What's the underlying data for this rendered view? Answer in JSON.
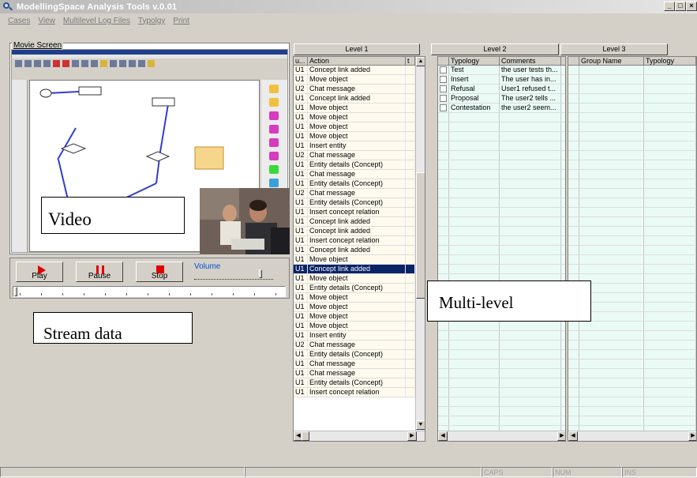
{
  "window": {
    "title": "ModellingSpace Analysis Tools v.0.01",
    "min": "_",
    "max": "□",
    "close": "×"
  },
  "menu": [
    "Cases",
    "View",
    "Multilevel Log Files",
    "Typolgy",
    "Print"
  ],
  "movie": {
    "title": "Movie Screen",
    "video_label": "Video",
    "controls": {
      "play": "Play",
      "pause": "Pause",
      "stop": "Stop",
      "volume_label": "Volume",
      "volume_level": 0.85
    },
    "stream_label": "Stream data"
  },
  "levels": {
    "level1": {
      "tab": "Level 1",
      "columns": [
        "u...",
        "Action",
        "t"
      ],
      "rows": [
        [
          "U1",
          "Concept link added"
        ],
        [
          "U1",
          "Move object"
        ],
        [
          "U2",
          "Chat message"
        ],
        [
          "U1",
          "Concept link added"
        ],
        [
          "U1",
          "Move object"
        ],
        [
          "U1",
          "Move object"
        ],
        [
          "U1",
          "Move object"
        ],
        [
          "U1",
          "Move object"
        ],
        [
          "U1",
          "Insert entity"
        ],
        [
          "U2",
          "Chat message"
        ],
        [
          "U1",
          "Entity details (Concept)"
        ],
        [
          "U1",
          "Chat message"
        ],
        [
          "U1",
          "Entity details (Concept)"
        ],
        [
          "U2",
          "Chat message"
        ],
        [
          "U1",
          "Entity details (Concept)"
        ],
        [
          "U1",
          "Insert concept relation"
        ],
        [
          "U1",
          "Concept link added"
        ],
        [
          "U1",
          "Concept link added"
        ],
        [
          "U1",
          "Insert concept relation"
        ],
        [
          "U1",
          "Concept link added"
        ],
        [
          "U1",
          "Move object"
        ],
        [
          "U1",
          "Concept link added"
        ],
        [
          "U1",
          "Move object"
        ],
        [
          "U1",
          "Entity details (Concept)"
        ],
        [
          "U1",
          "Move object"
        ],
        [
          "U1",
          "Move object"
        ],
        [
          "U1",
          "Move object"
        ],
        [
          "U1",
          "Move object"
        ],
        [
          "U1",
          "Insert entity"
        ],
        [
          "U2",
          "Chat message"
        ],
        [
          "U1",
          "Entity details (Concept)"
        ],
        [
          "U1",
          "Chat message"
        ],
        [
          "U1",
          "Chat message"
        ],
        [
          "U1",
          "Entity details (Concept)"
        ],
        [
          "U1",
          "Insert concept relation"
        ]
      ],
      "selected_index": 21
    },
    "level2": {
      "tab": "Level 2",
      "columns": [
        "Typology",
        "Comments"
      ],
      "rows": [
        [
          "Test",
          "the user tests th..."
        ],
        [
          "Insert",
          "The user has in..."
        ],
        [
          "Refusal",
          "User1 refused t..."
        ],
        [
          "Proposal",
          "The user2 tells ..."
        ],
        [
          "Contestation",
          "the user2 seem..."
        ]
      ]
    },
    "level3": {
      "tab": "Level 3",
      "columns": [
        "Group Name",
        "Typology"
      ]
    }
  },
  "multi_label": "Multi-level",
  "status": {
    "caps": "CAPS",
    "num": "NUM",
    "ins": "INS"
  }
}
